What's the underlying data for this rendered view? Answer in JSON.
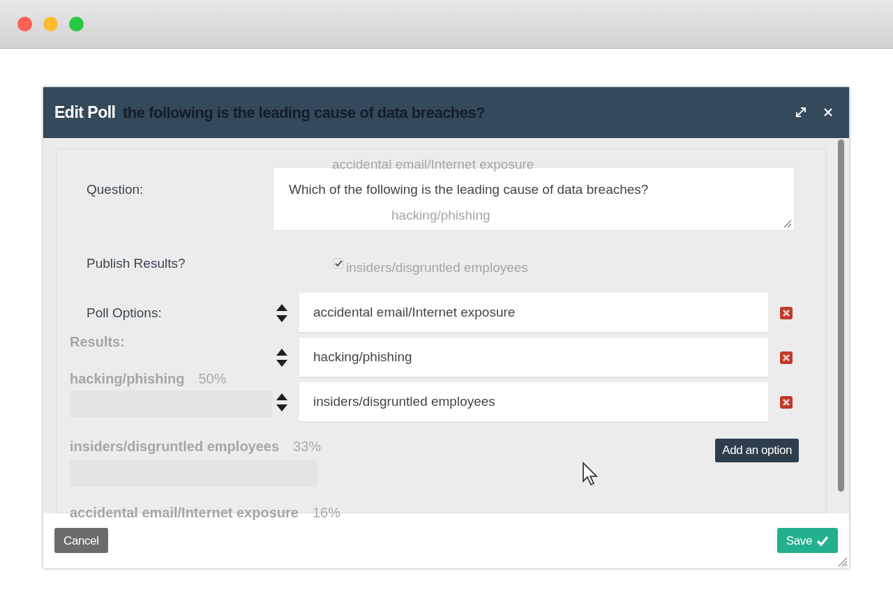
{
  "dialog": {
    "title": "Edit Poll",
    "question": {
      "label": "Question:",
      "value": "Which of the following is the leading cause of data breaches?"
    },
    "publish_results": {
      "label": "Publish Results?",
      "checked": true
    },
    "poll_options": {
      "label": "Poll Options:",
      "options": [
        {
          "value": "accidental email/Internet exposure"
        },
        {
          "value": "hacking/phishing"
        },
        {
          "value": "insiders/disgruntled employees"
        }
      ]
    },
    "add_button": "Add an option",
    "cancel_button": "Cancel",
    "save_button": "Save"
  },
  "background_page": {
    "heading": "the following is the leading cause of data breaches?",
    "options": [
      "accidental email/Internet exposure",
      "hacking/phishing",
      "insiders/disgruntled employees"
    ],
    "results_label": "Results:",
    "results": [
      {
        "option": "hacking/phishing",
        "percent": "50%"
      },
      {
        "option": "insiders/disgruntled employees",
        "percent": "33%"
      },
      {
        "option": "accidental email/Internet exposure",
        "percent": "16%"
      }
    ]
  }
}
